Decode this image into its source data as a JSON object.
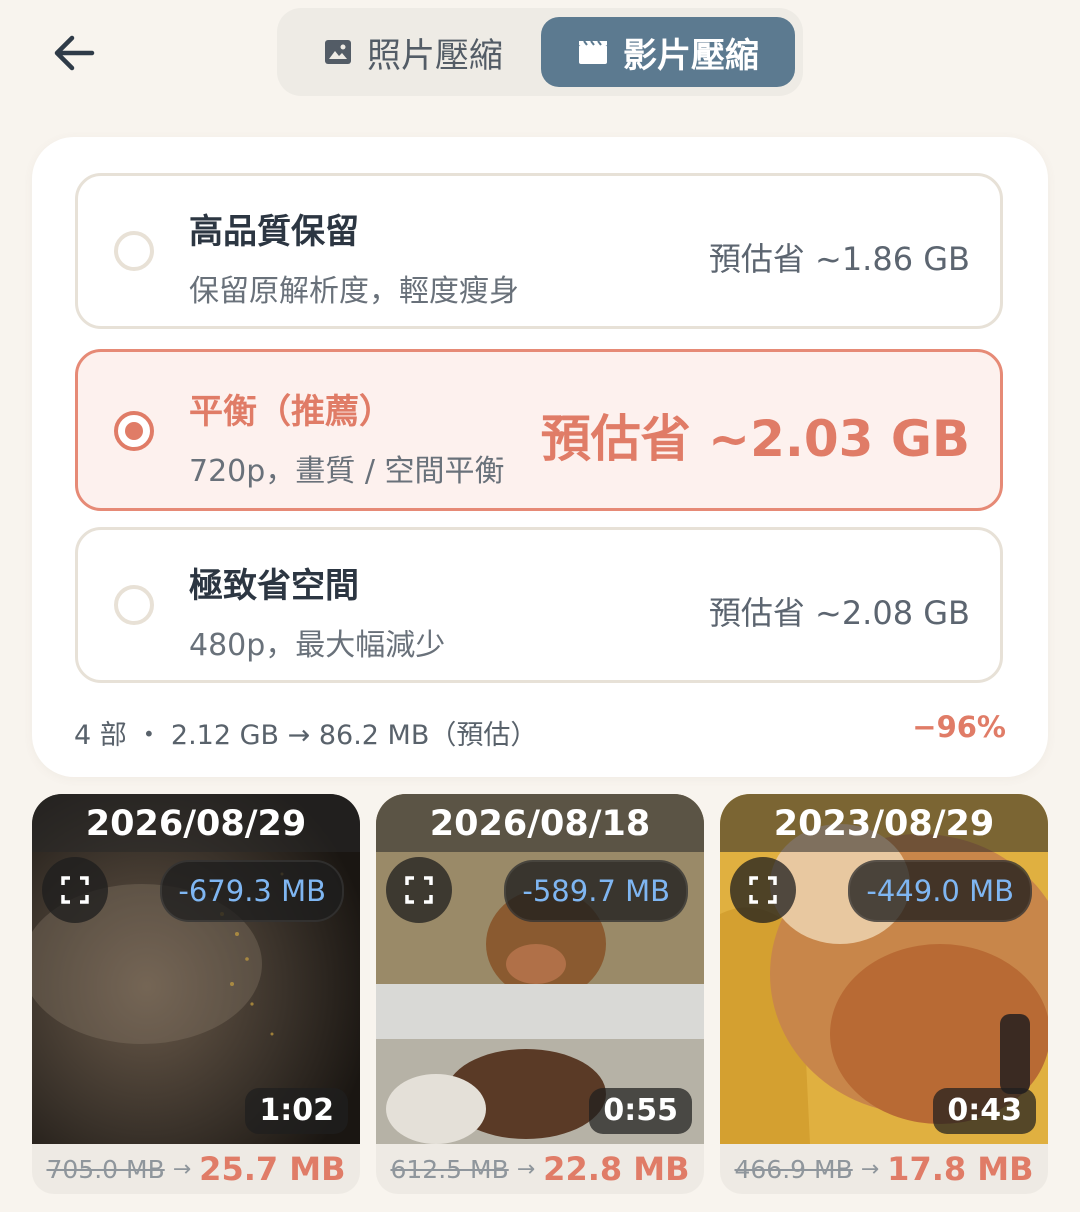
{
  "header": {
    "tabs": [
      {
        "label": "照片壓縮",
        "icon": "image-icon",
        "active": false
      },
      {
        "label": "影片壓縮",
        "icon": "film-icon",
        "active": true
      }
    ]
  },
  "options": [
    {
      "title": "高品質保留",
      "desc": "保留原解析度，輕度瘦身",
      "estimate": "預估省 ~1.86 GB",
      "selected": false
    },
    {
      "title": "平衡（推薦）",
      "desc": "720p，畫質 / 空間平衡",
      "estimate": "預估省 ~2.03 GB",
      "selected": true
    },
    {
      "title": "極致省空間",
      "desc": "480p，最大幅減少",
      "estimate": "預估省 ~2.08 GB",
      "selected": false
    }
  ],
  "summary": {
    "text": "4 部 ・ 2.12 GB → 86.2 MB（預估）",
    "percent": "−96%"
  },
  "videos": [
    {
      "date": "2026/08/29",
      "saving": "-679.3 MB",
      "duration": "1:02",
      "original": "705.0 MB",
      "compressed": "25.7 MB"
    },
    {
      "date": "2026/08/18",
      "saving": "-589.7 MB",
      "duration": "0:55",
      "original": "612.5 MB",
      "compressed": "22.8 MB"
    },
    {
      "date": "2023/08/29",
      "saving": "-449.0 MB",
      "duration": "0:43",
      "original": "466.9 MB",
      "compressed": "17.8 MB"
    }
  ],
  "colors": {
    "accent": "#e07c67",
    "active_tab": "#5c7a90",
    "saving_text": "#7fb6f2"
  }
}
